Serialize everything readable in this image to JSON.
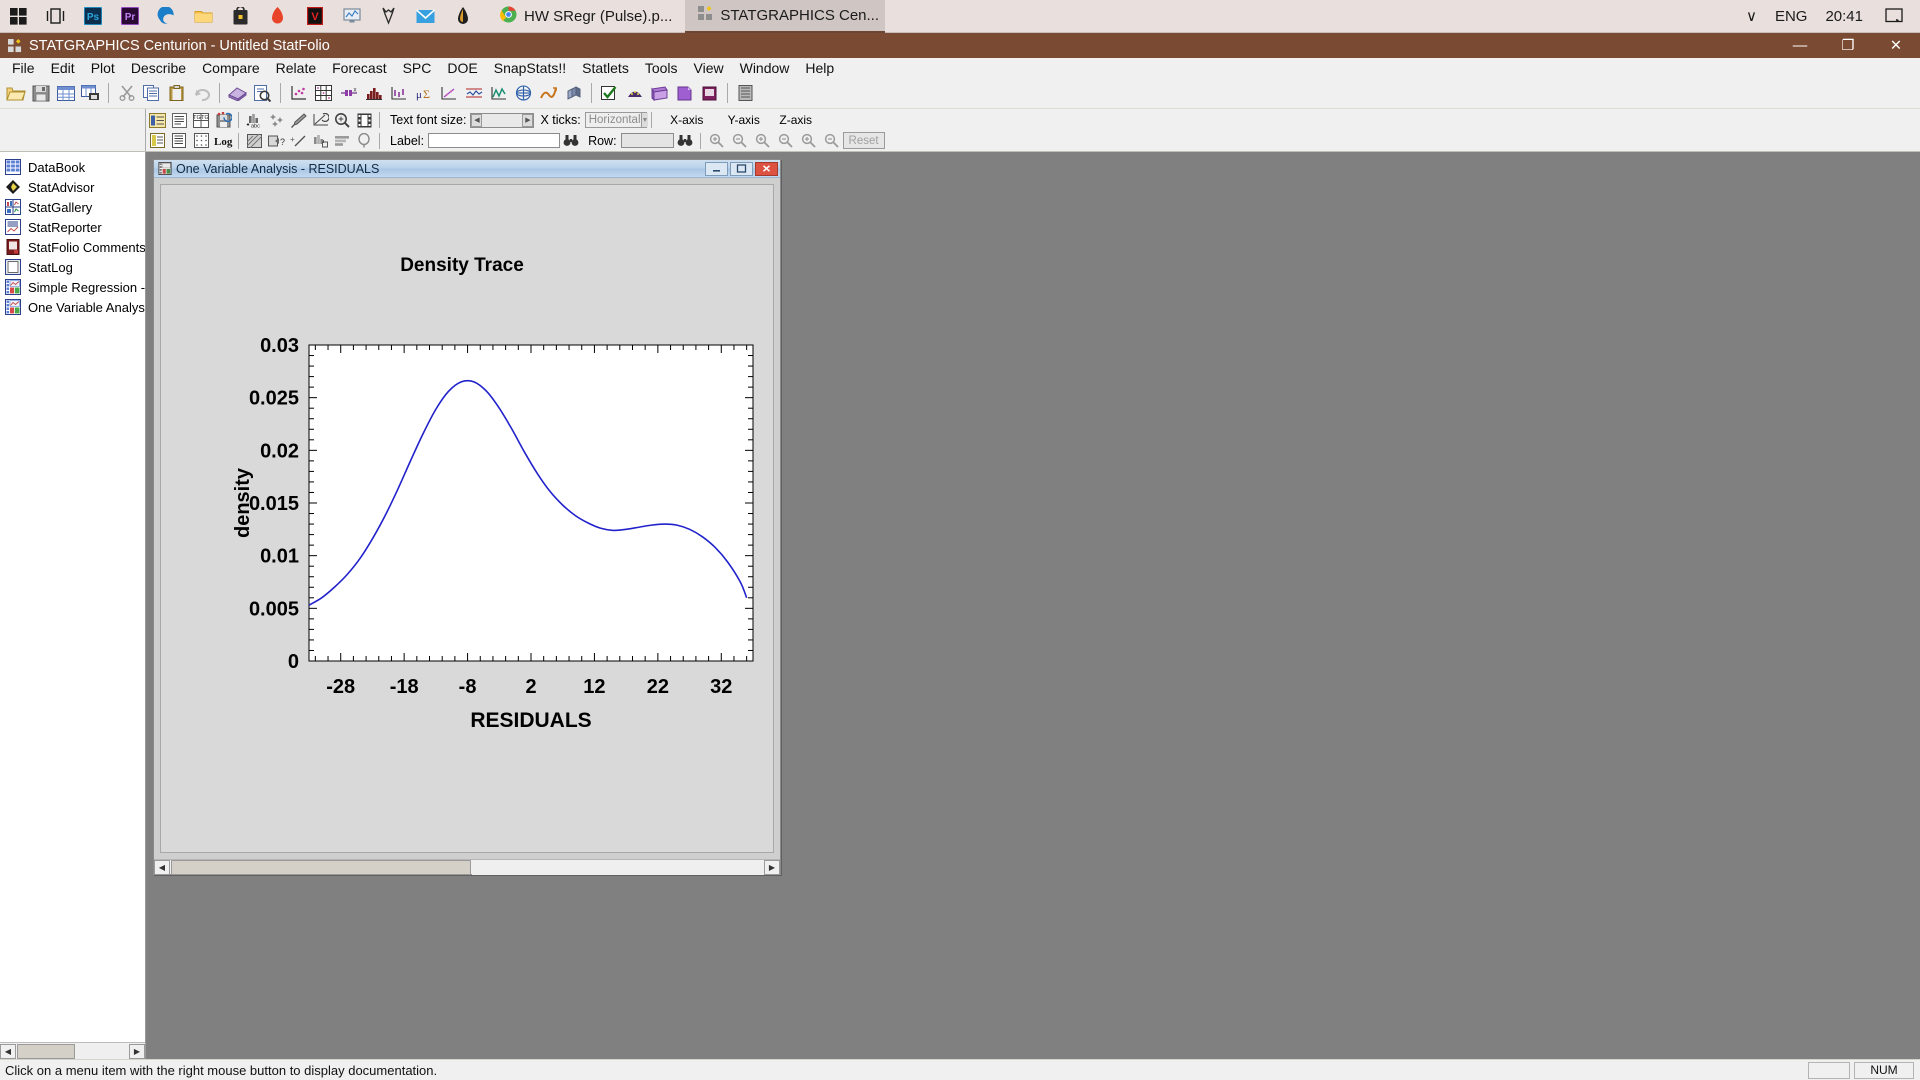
{
  "taskbar": {
    "icons": [
      {
        "name": "start-icon",
        "glyph": "windows"
      },
      {
        "name": "task-view-icon",
        "glyph": "taskview"
      },
      {
        "name": "photoshop-icon",
        "glyph": "ps",
        "label": "Ps"
      },
      {
        "name": "premiere-icon",
        "glyph": "pr",
        "label": "Pr"
      },
      {
        "name": "edge-icon",
        "glyph": "edge",
        "label": "e"
      },
      {
        "name": "file-explorer-icon",
        "glyph": "folder"
      },
      {
        "name": "microsoft-store-icon",
        "glyph": "store"
      },
      {
        "name": "office-icon",
        "glyph": "office"
      },
      {
        "name": "vegas-icon",
        "glyph": "vegas",
        "label": "V"
      },
      {
        "name": "monitor-app-icon",
        "glyph": "monitor"
      },
      {
        "name": "fox-icon",
        "glyph": "fox"
      },
      {
        "name": "mail-icon",
        "glyph": "mail"
      },
      {
        "name": "acrobat-icon",
        "glyph": "acrobat"
      }
    ],
    "tasks": [
      {
        "name": "taskbar-task-chrome",
        "label": "HW SRegr (Pulse).p...",
        "icon": "chrome-icon",
        "active": false
      },
      {
        "name": "taskbar-task-statgraphics",
        "label": "STATGRAPHICS Cen...",
        "icon": "statgraphics-icon",
        "active": true
      }
    ],
    "tray": {
      "chevron": "∨",
      "language": "ENG",
      "clock": "20:41",
      "notification_icon": "notification-icon"
    }
  },
  "window": {
    "title": "STATGRAPHICS Centurion - Untitled StatFolio",
    "minimize": "—",
    "maximize": "❐",
    "close": "✕"
  },
  "menu": {
    "items": [
      "File",
      "Edit",
      "Plot",
      "Describe",
      "Compare",
      "Relate",
      "Forecast",
      "SPC",
      "DOE",
      "SnapStats!!",
      "Statlets",
      "Tools",
      "View",
      "Window",
      "Help"
    ]
  },
  "toolbar": {
    "buttons": [
      {
        "name": "open-statfolio-button",
        "icon": "folder-open-icon"
      },
      {
        "name": "save-button",
        "icon": "floppy-disk-icon"
      },
      {
        "name": "datasheet-button",
        "icon": "grid-icon"
      },
      {
        "name": "print-datasheet-button",
        "icon": "grid-print-icon"
      },
      {
        "name": "cut-button",
        "icon": "scissors-icon"
      },
      {
        "name": "copy-button",
        "icon": "copy-icon"
      },
      {
        "name": "paste-button",
        "icon": "clipboard-icon"
      },
      {
        "name": "undo-button",
        "icon": "undo-arrow-icon"
      },
      {
        "name": "statadvisor-button",
        "icon": "book-icon"
      },
      {
        "name": "stat-preview-button",
        "icon": "page-magnifier-icon"
      },
      {
        "name": "scatterplot-button",
        "icon": "scatter-icon"
      },
      {
        "name": "matrix-plot-button",
        "icon": "matrix-icon"
      },
      {
        "name": "box-whisker-button",
        "icon": "boxplot-icon"
      },
      {
        "name": "histogram-button",
        "icon": "histogram-icon"
      },
      {
        "name": "multi-plot-button",
        "icon": "multiplot-icon"
      },
      {
        "name": "capability-button",
        "icon": "sigma-icon"
      },
      {
        "name": "special-plot-button",
        "icon": "sparkle-plot-icon"
      },
      {
        "name": "control-chart-button",
        "icon": "controlchart-icon"
      },
      {
        "name": "timeseries-button",
        "icon": "timeseries-icon"
      },
      {
        "name": "surface-plot-button",
        "icon": "surface-icon"
      },
      {
        "name": "trend-plot-button",
        "icon": "trend-icon"
      },
      {
        "name": "bar3d-button",
        "icon": "bar3d-icon"
      },
      {
        "name": "check-button",
        "icon": "check-icon"
      },
      {
        "name": "doe-button",
        "icon": "doe-icon"
      },
      {
        "name": "statgallery-button",
        "icon": "gallery-icon"
      },
      {
        "name": "statreporter-button",
        "icon": "reporter-icon"
      },
      {
        "name": "statfolio-comments-button",
        "icon": "comments-icon"
      },
      {
        "name": "statlog-button",
        "icon": "log-icon"
      }
    ]
  },
  "graphics_toolbar": {
    "row1": [
      {
        "name": "graph-options-button",
        "icon": "graph-options-icon"
      },
      {
        "name": "pane-options-button",
        "icon": "pane-options-icon"
      },
      {
        "name": "text-swap-button",
        "icon": "tg-swap-icon"
      },
      {
        "name": "save-graph-button",
        "icon": "save-graph-icon"
      },
      {
        "name": "add-text-button",
        "icon": "add-text-icon"
      },
      {
        "name": "add-point-button",
        "icon": "add-point-icon"
      },
      {
        "name": "paintbrush-button",
        "icon": "paintbrush-icon"
      },
      {
        "name": "smooth-button",
        "icon": "smooth-icon"
      },
      {
        "name": "magnifier-button",
        "icon": "magnifier-icon"
      },
      {
        "name": "film-button",
        "icon": "film-icon"
      }
    ],
    "row2": [
      {
        "name": "report-button",
        "icon": "report-icon"
      },
      {
        "name": "tables-button",
        "icon": "tables-icon"
      },
      {
        "name": "dotted-grid-button",
        "icon": "dotted-grid-icon"
      },
      {
        "name": "log-scale-button",
        "icon": "log-icon",
        "label": "Log"
      },
      {
        "name": "hatch-button",
        "icon": "hatch-icon"
      },
      {
        "name": "identify-point-button",
        "icon": "identify-icon"
      },
      {
        "name": "axis-scale-button",
        "icon": "axis-scale-icon"
      },
      {
        "name": "bar-style-button",
        "icon": "bar-style-icon"
      },
      {
        "name": "layers-button",
        "icon": "layers-icon"
      },
      {
        "name": "balloon-button",
        "icon": "balloon-icon"
      }
    ],
    "text_font_size": {
      "label": "Text font size:",
      "value": "",
      "left_arrow": "◀",
      "right_arrow": "▶"
    },
    "x_ticks": {
      "label": "X ticks:",
      "value": "Horizontal",
      "arrow": "▼"
    },
    "label_field": {
      "label": "Label:",
      "value": "",
      "binoculars_icon": "binoculars-icon"
    },
    "row_field": {
      "label": "Row:",
      "value": "",
      "binoculars_icon": "binoculars-icon"
    },
    "axes": [
      {
        "name": "x-axis-group",
        "label": "X-axis",
        "zoom_in": "zoom-in-icon",
        "zoom_out": "zoom-out-icon"
      },
      {
        "name": "y-axis-group",
        "label": "Y-axis",
        "zoom_in": "zoom-in-icon",
        "zoom_out": "zoom-out-icon"
      },
      {
        "name": "z-axis-group",
        "label": "Z-axis",
        "zoom_in": "zoom-in-icon",
        "zoom_out": "zoom-out-icon"
      }
    ],
    "reset_button": "Reset"
  },
  "sidebar": {
    "items": [
      {
        "name": "sidebar-item-databook",
        "label": "DataBook",
        "icon": "databook-icon"
      },
      {
        "name": "sidebar-item-statadvisor",
        "label": "StatAdvisor",
        "icon": "statadvisor-icon"
      },
      {
        "name": "sidebar-item-statgallery",
        "label": "StatGallery",
        "icon": "statgallery-icon"
      },
      {
        "name": "sidebar-item-statreporter",
        "label": "StatReporter",
        "icon": "statreporter-icon"
      },
      {
        "name": "sidebar-item-statfolio-comments",
        "label": "StatFolio Comments",
        "icon": "comments-book-icon"
      },
      {
        "name": "sidebar-item-statlog",
        "label": "StatLog",
        "icon": "statlog-icon"
      },
      {
        "name": "sidebar-item-simple-regression",
        "label": "Simple Regression - Puls",
        "icon": "analysis-icon"
      },
      {
        "name": "sidebar-item-one-variable-analysis",
        "label": "One Variable Analysis - ",
        "icon": "analysis-icon"
      }
    ],
    "scroll_left": "◀",
    "scroll_right": "▶"
  },
  "child_window": {
    "title": "One Variable Analysis - RESIDUALS",
    "icon": "analysis-icon",
    "minimize": "–",
    "maximize": "❐",
    "close": "✕"
  },
  "statusbar": {
    "message": "Click on a menu item with the right mouse button to display documentation.",
    "num_indicator": "NUM"
  },
  "chart_data": {
    "type": "line",
    "title": "Density Trace",
    "xlabel": "RESIDUALS",
    "ylabel": "density",
    "xlim": [
      -33,
      37
    ],
    "ylim": [
      0,
      0.03
    ],
    "xticks": [
      -28,
      -18,
      -8,
      2,
      12,
      22,
      32
    ],
    "xtick_labels": [
      "-28",
      "-18",
      "-8",
      "2",
      "12",
      "22",
      "32"
    ],
    "yticks": [
      0,
      0.005,
      0.01,
      0.015,
      0.02,
      0.025,
      0.03
    ],
    "ytick_labels": [
      "0",
      "0.005",
      "0.01",
      "0.015",
      "0.02",
      "0.025",
      "0.03"
    ],
    "minor_ticks_per_interval": 5,
    "grid": false,
    "legend": "none",
    "line_color": "#2222cc",
    "plot_bg": "#ffffff",
    "pane_bg": "#d9d9d9",
    "series": [
      {
        "name": "density",
        "x": [
          -33,
          -31,
          -29,
          -27,
          -25,
          -23,
          -21,
          -19,
          -17,
          -15,
          -13,
          -11,
          -9,
          -7,
          -5,
          -3,
          -1,
          1,
          3,
          5,
          7,
          9,
          11,
          13,
          15,
          17,
          19,
          21,
          23,
          25,
          27,
          29,
          31,
          33,
          35,
          36
        ],
        "y": [
          0.0053,
          0.006,
          0.007,
          0.0082,
          0.0097,
          0.0116,
          0.0138,
          0.0163,
          0.019,
          0.0216,
          0.0239,
          0.0256,
          0.0265,
          0.0265,
          0.0256,
          0.024,
          0.022,
          0.0198,
          0.0178,
          0.0161,
          0.0148,
          0.0138,
          0.0131,
          0.0126,
          0.0124,
          0.0125,
          0.0127,
          0.0129,
          0.013,
          0.0129,
          0.0125,
          0.0118,
          0.0108,
          0.0094,
          0.0075,
          0.006
        ]
      }
    ]
  }
}
